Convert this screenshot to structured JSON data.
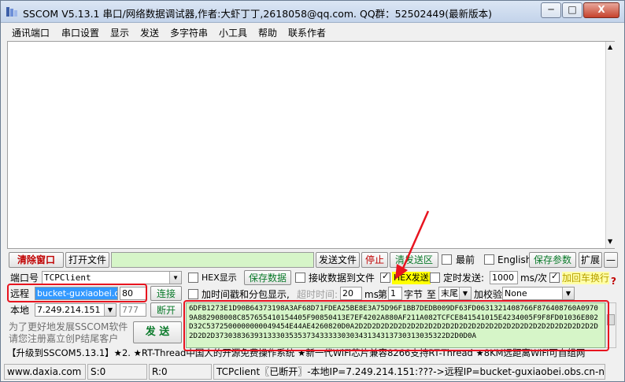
{
  "window": {
    "title": "SSCOM V5.13.1 串口/网络数据调试器,作者:大虾丁丁,2618058@qq.com. QQ群：52502449(最新版本)",
    "controls": {
      "minimize": "─",
      "maximize": "□",
      "close": "X"
    }
  },
  "menu": [
    "通讯端口",
    "串口设置",
    "显示",
    "发送",
    "多字符串",
    "小工具",
    "帮助",
    "联系作者"
  ],
  "toolbar": {
    "clear_window": "清除窗口",
    "open_file": "打开文件",
    "send_file": "发送文件",
    "stop": "停止",
    "clear_send": "清发送区",
    "topmost_label": "最前",
    "english_label": "English",
    "save_params": "保存参数",
    "expand": "扩展",
    "collapse": "—"
  },
  "port_row": {
    "port_label": "端口号",
    "port_value": "TCPClient",
    "hex_display_label": "HEX显示",
    "save_data": "保存数据",
    "recv_to_file_label": "接收数据到文件",
    "hex_send_label": "HEX发送",
    "timed_send_label": "定时发送:",
    "interval_value": "1000",
    "interval_unit": "ms/次",
    "add_crlf_label": "加回车换行"
  },
  "remote_row": {
    "remote_label": "远程",
    "remote_host": "bucket-guxiaobei.obs.",
    "remote_port": "80",
    "connect": "连接",
    "timestamp_label": "加时间戳和分包显示,",
    "timeout_label": "超时时间:",
    "timeout_value": "20",
    "timeout_unit": "ms",
    "nth_label": "第",
    "nth_value": "1",
    "byte_label": "字节",
    "to_label": "至",
    "end_value": "末尾",
    "checksum_label": "加校验",
    "checksum_value": "None"
  },
  "local_row": {
    "local_label": "本地",
    "local_ip": "7.249.214.151",
    "local_port": "777",
    "disconnect": "断开"
  },
  "promo": {
    "line1": "为了更好地发展SSCOM软件",
    "line2": "请您注册嘉立创P结尾客户",
    "send_button": "发 送"
  },
  "send_data": "6DFB1273E1D90B64373198A3AF68D71FDEA25BE8E3A75D96F1BB7DEDB009DF63FD0631321408766F876408760A09709A882908008C857655410154405F90850413E7EF4202A880AF211A082TCFCE841541015E4234005F9F8FD01036E802D32C5372500000000049454E44AE4260820D0A2D2D2D2D2D2D2D2D2D2D2D2D2D2D2D2D2D2D2D2D2D2D2D2D2D2D2D2D2D2D2D37303836393133303535373433333030343134313730313035322D2D0D0A",
  "ticker": "【升级到SSCOM5.13.1】★2. ★RT-Thread中国人的开源免费操作系统 ★新一代WiFi芯片兼容8266支持RT-Thread ★8KM远距离WiFi可自组网",
  "status": {
    "website": "www.daxia.com",
    "sent": "S:0",
    "received": "R:0",
    "connection": "TCPclient〖已断开〗-本地IP=7.249.214.151:???->远程IP=bucket-guxiaobei.obs.cn-north"
  },
  "colors": {
    "annotation_red": "#e8141f",
    "send_area_bg": "#d6f5c8",
    "hex_send_highlight": "#ffff00",
    "title_bar": "#c3d3ea"
  }
}
